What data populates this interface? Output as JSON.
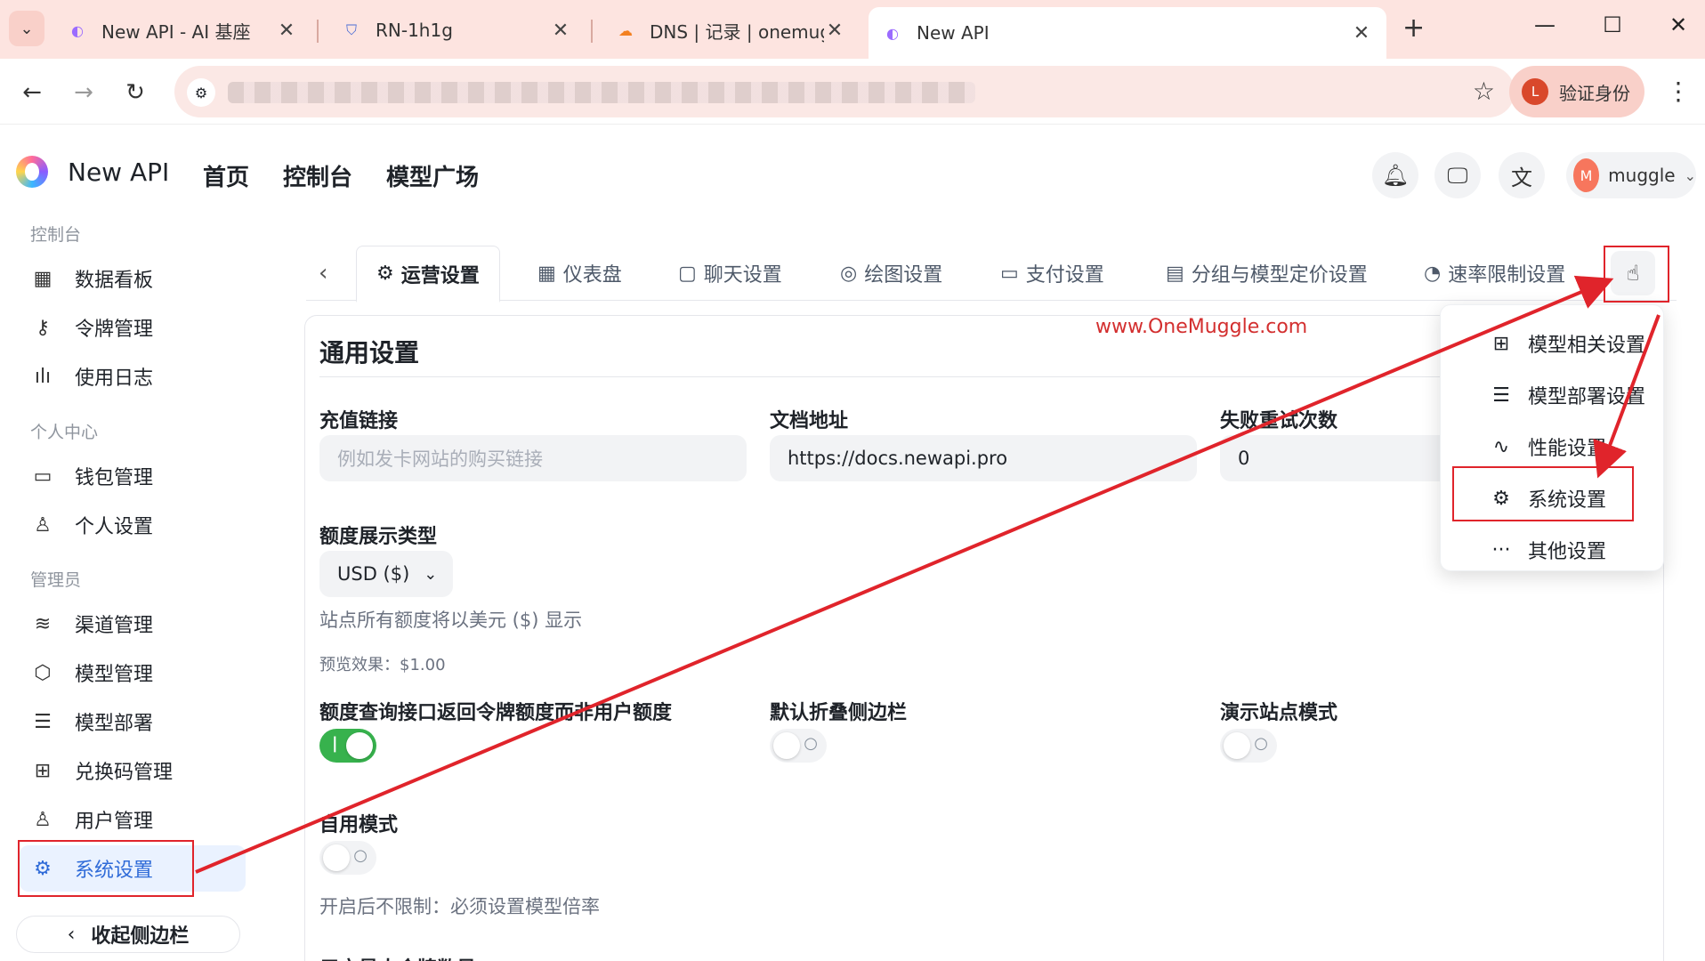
{
  "browser": {
    "tabs": [
      {
        "title": "New API - AI 基座",
        "favicon": "newapi-icon"
      },
      {
        "title": "RN-1h1g",
        "favicon": "shield-icon"
      },
      {
        "title": "DNS | 记录 | onemuggle.com",
        "favicon": "cloudflare-icon"
      },
      {
        "title": "New API",
        "favicon": "newapi-icon"
      }
    ],
    "verify_label": "验证身份",
    "verify_initial": "L"
  },
  "app": {
    "brand": "New API",
    "nav": [
      "首页",
      "控制台",
      "模型广场"
    ],
    "user": {
      "initial": "M",
      "name": "muggle"
    }
  },
  "sidebar": {
    "sections": [
      {
        "title": "控制台",
        "items": [
          {
            "label": "数据看板",
            "icon": "dashboard-icon"
          },
          {
            "label": "令牌管理",
            "icon": "key-icon"
          },
          {
            "label": "使用日志",
            "icon": "bar-chart-icon"
          }
        ]
      },
      {
        "title": "个人中心",
        "items": [
          {
            "label": "钱包管理",
            "icon": "wallet-icon"
          },
          {
            "label": "个人设置",
            "icon": "user-icon"
          }
        ]
      },
      {
        "title": "管理员",
        "items": [
          {
            "label": "渠道管理",
            "icon": "layers-icon"
          },
          {
            "label": "模型管理",
            "icon": "box-icon"
          },
          {
            "label": "模型部署",
            "icon": "server-icon"
          },
          {
            "label": "兑换码管理",
            "icon": "gift-icon"
          },
          {
            "label": "用户管理",
            "icon": "user-icon"
          },
          {
            "label": "系统设置",
            "icon": "gear-icon",
            "active": true
          }
        ]
      }
    ],
    "collapse_label": "收起侧边栏"
  },
  "settings_tabs": [
    {
      "label": "运营设置",
      "icon": "gear-icon",
      "active": true
    },
    {
      "label": "仪表盘",
      "icon": "dashboard-icon"
    },
    {
      "label": "聊天设置",
      "icon": "chat-icon"
    },
    {
      "label": "绘图设置",
      "icon": "palette-icon"
    },
    {
      "label": "支付设置",
      "icon": "card-icon"
    },
    {
      "label": "分组与模型定价设置",
      "icon": "calculator-icon"
    },
    {
      "label": "速率限制设置",
      "icon": "gauge-icon"
    }
  ],
  "watermark": "www.OneMuggle.com",
  "general": {
    "title": "通用设置",
    "topup_link": {
      "label": "充值链接",
      "placeholder": "例如发卡网站的购买链接",
      "value": ""
    },
    "docs_url": {
      "label": "文档地址",
      "value": "https://docs.newapi.pro"
    },
    "retry_times": {
      "label": "失败重试次数",
      "value": "0"
    },
    "quota_display": {
      "label": "额度展示类型",
      "value": "USD ($)",
      "help": "站点所有额度将以美元 ($) 显示",
      "preview": "预览效果：$1.00"
    },
    "toggles": [
      {
        "label": "额度查询接口返回令牌额度而非用户额度",
        "on": true
      },
      {
        "label": "默认折叠侧边栏",
        "on": false
      },
      {
        "label": "演示站点模式",
        "on": false
      },
      {
        "label": "自用模式",
        "on": false
      }
    ],
    "self_use_help": "开启后不限制：必须设置模型倍率",
    "next_label": "用户最大令牌数量"
  },
  "more_menu": [
    {
      "label": "模型相关设置",
      "icon": "apps-icon"
    },
    {
      "label": "模型部署设置",
      "icon": "server-icon"
    },
    {
      "label": "性能设置",
      "icon": "activity-icon"
    },
    {
      "label": "系统设置",
      "icon": "gear-icon"
    },
    {
      "label": "其他设置",
      "icon": "more-icon"
    }
  ],
  "colors": {
    "accent": "#2f6bd8",
    "toggle_on": "#37b24d",
    "annotation": "#e0242b",
    "tabbar": "#fde4e0"
  }
}
